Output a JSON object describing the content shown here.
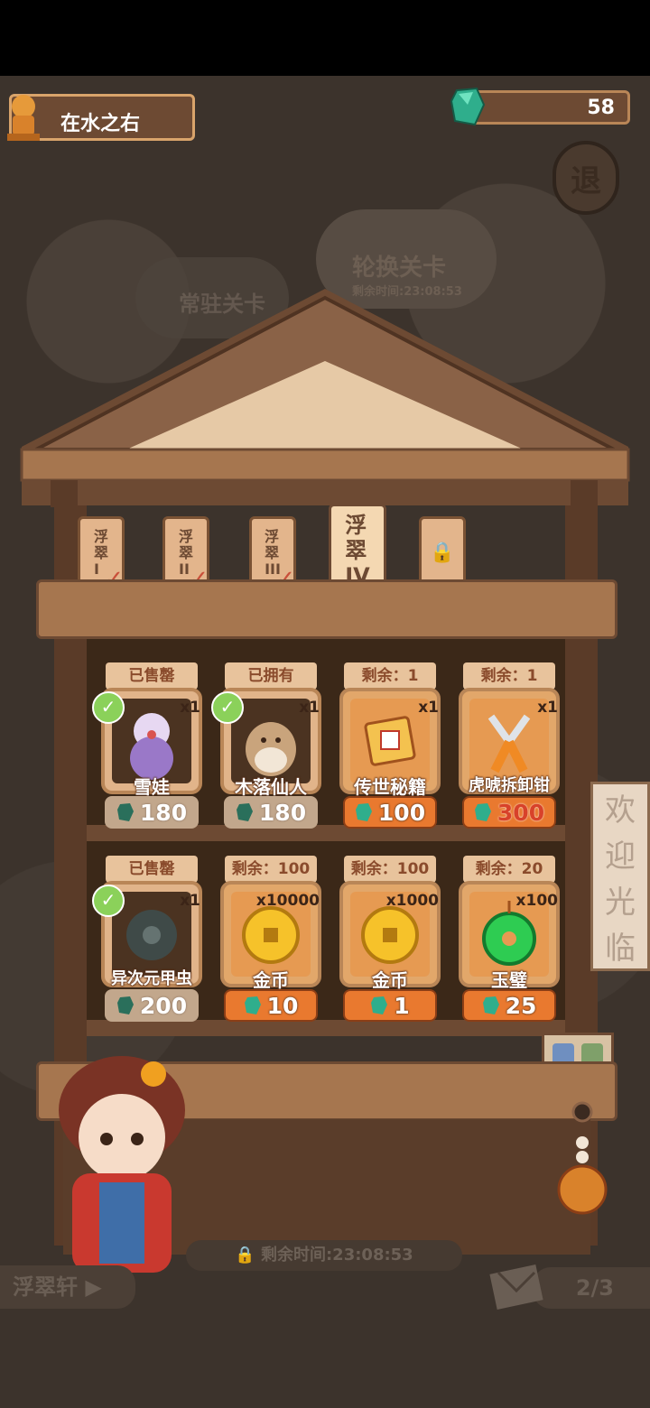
{
  "player": {
    "name": "在水之右"
  },
  "currency": {
    "gems": "58"
  },
  "exit_label": "退",
  "stage_tabs": {
    "regular": "常驻关卡",
    "rotating": "轮换关卡",
    "rotating_timer": "剩余时间:23:08:53"
  },
  "tiers": [
    {
      "label": "浮翠\nI",
      "completed": true
    },
    {
      "label": "浮翠\nII",
      "completed": true
    },
    {
      "label": "浮翠\nIII",
      "completed": true
    },
    {
      "label": "浮翠\nIV",
      "active": true
    },
    {
      "label": "locked",
      "locked": true
    }
  ],
  "items": [
    {
      "tag": "已售罄",
      "qty": "x1",
      "name": "雪娃",
      "price": "180",
      "sold": true
    },
    {
      "tag": "已拥有",
      "qty": "x1",
      "name": "木落仙人",
      "price": "180",
      "sold": true
    },
    {
      "tag": "剩余：1",
      "qty": "x1",
      "name": "传世秘籍",
      "price": "100",
      "sold": false
    },
    {
      "tag": "剩余：1",
      "qty": "x1",
      "name": "虎唬拆卸钳",
      "price": "300",
      "sold": false
    },
    {
      "tag": "已售罄",
      "qty": "x1",
      "name": "异次元甲虫",
      "price": "200",
      "sold": true
    },
    {
      "tag": "剩余：100",
      "qty": "x10000",
      "name": "金币",
      "price": "10",
      "sold": false
    },
    {
      "tag": "剩余：100",
      "qty": "x1000",
      "name": "金币",
      "price": "1",
      "sold": false
    },
    {
      "tag": "剩余：20",
      "qty": "x100",
      "name": "玉璧",
      "price": "25",
      "sold": false
    }
  ],
  "welcome_sign": [
    "欢",
    "迎",
    "光",
    "临"
  ],
  "bottom_timer": "剩余时间:23:08:53",
  "store_name": "浮翠轩",
  "page_indicator": "2/3",
  "colors": {
    "gem": "#2fae8c",
    "price_active": "#e9792f",
    "price_sold": "#c2a78c",
    "wood": "#a6764f"
  }
}
